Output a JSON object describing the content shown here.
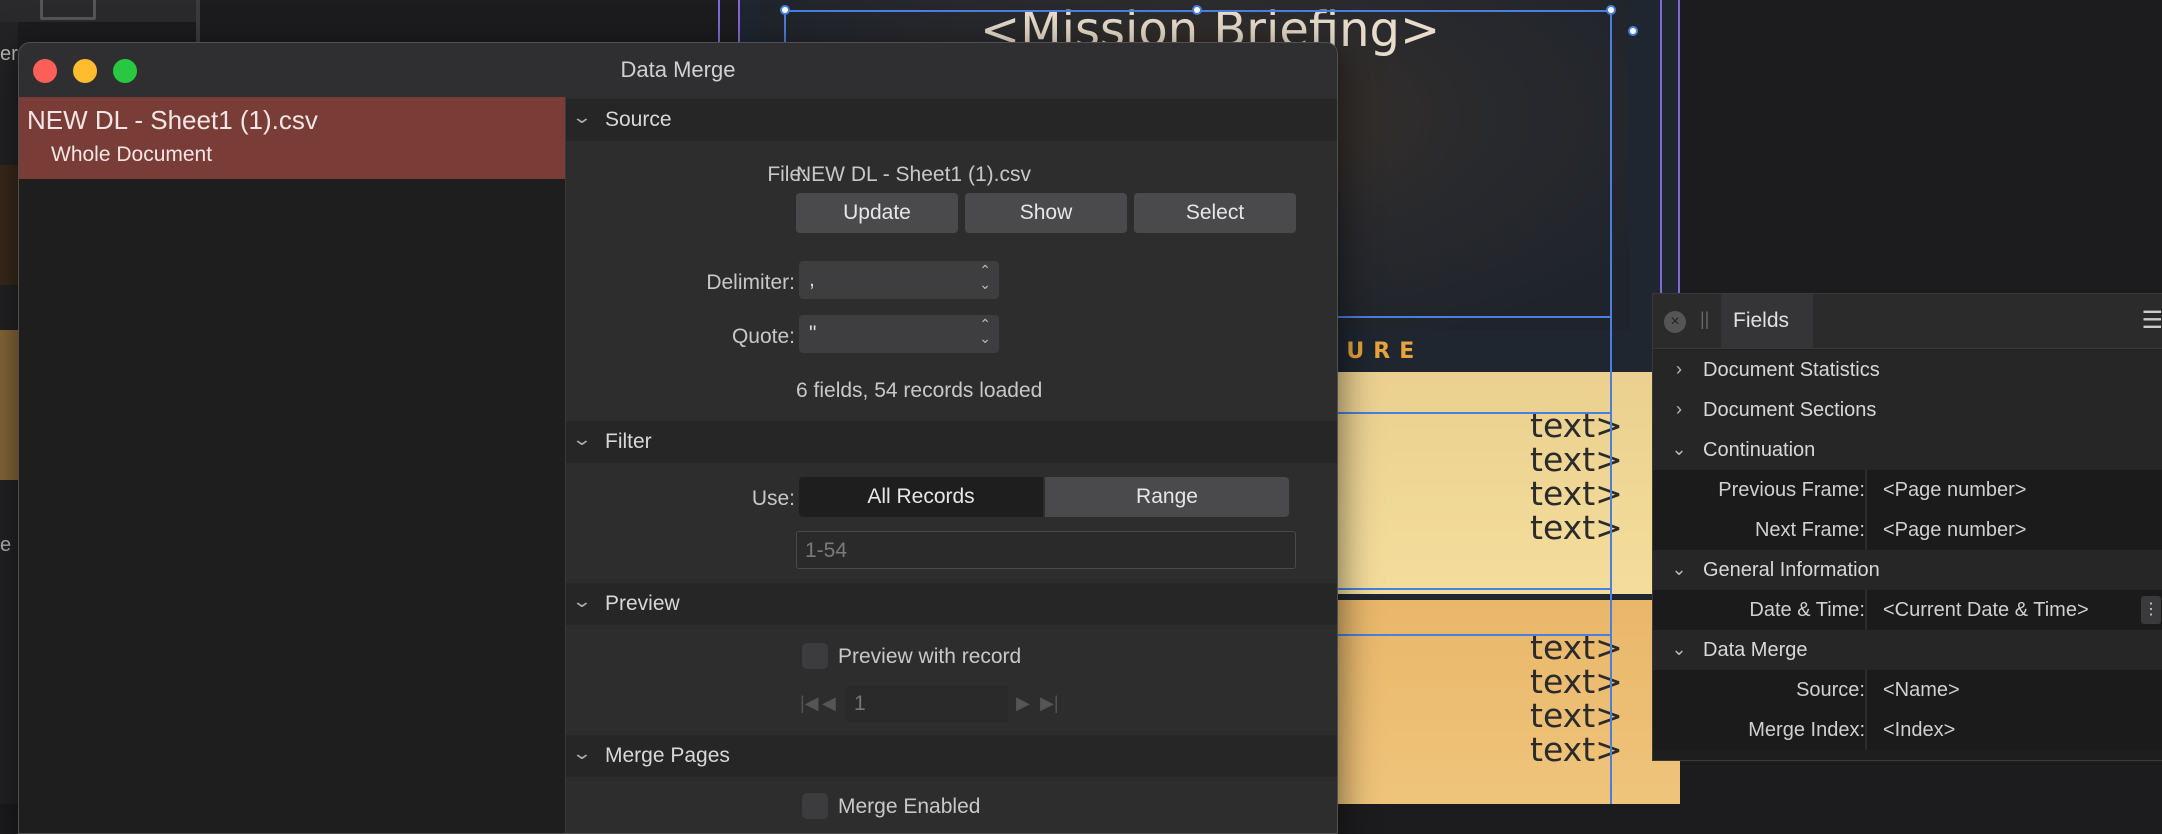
{
  "window": {
    "title": "Data Merge"
  },
  "background": {
    "document_title": "<Mission Briefing>",
    "document_subtitle": "NTURE",
    "placeholder_text": "text>",
    "left_fragment_1": "er",
    "left_fragment_2": "e"
  },
  "sidebar": {
    "source_file": "NEW DL - Sheet1 (1).csv",
    "scope": "Whole Document"
  },
  "source": {
    "heading": "Source",
    "file_label": "File:",
    "file_value": "NEW DL - Sheet1 (1).csv",
    "buttons": [
      "Update",
      "Show",
      "Select"
    ],
    "delimiter_label": "Delimiter:",
    "delimiter_value": ",",
    "quote_label": "Quote:",
    "quote_value": "\"",
    "status": "6 fields, 54 records loaded"
  },
  "filter": {
    "heading": "Filter",
    "use_label": "Use:",
    "options": [
      "All Records",
      "Range"
    ],
    "selected": "All Records",
    "range_placeholder": "1-54"
  },
  "preview": {
    "heading": "Preview",
    "checkbox_label": "Preview with record",
    "record_value": "1"
  },
  "merge_pages": {
    "heading": "Merge Pages",
    "checkbox_label": "Merge Enabled"
  },
  "fields_panel": {
    "tab": "Fields",
    "groups": [
      {
        "name": "Document Statistics",
        "expanded": false
      },
      {
        "name": "Document Sections",
        "expanded": false
      },
      {
        "name": "Continuation",
        "expanded": true,
        "items": [
          {
            "key": "Previous Frame:",
            "value": "<Page number>"
          },
          {
            "key": "Next Frame:",
            "value": "<Page number>"
          }
        ]
      },
      {
        "name": "General Information",
        "expanded": true,
        "items": [
          {
            "key": "Date & Time:",
            "value": "<Current Date & Time>"
          }
        ]
      },
      {
        "name": "Data Merge",
        "expanded": true,
        "items": [
          {
            "key": "Source:",
            "value": "<Name>"
          },
          {
            "key": "Merge Index:",
            "value": "<Index>"
          }
        ]
      }
    ]
  },
  "icons": {
    "close": "close-icon",
    "chevron_down": "chevron-down-icon",
    "chevron_right": "chevron-right-icon",
    "menu": "menu-icon"
  },
  "colors": {
    "accent_selection": "#7a3c37",
    "traffic_close": "#ff5f57",
    "traffic_minimize": "#febc2e",
    "traffic_zoom": "#28c840",
    "frame_selection": "#4a7fe0",
    "document_accent": "#e8a33c"
  }
}
